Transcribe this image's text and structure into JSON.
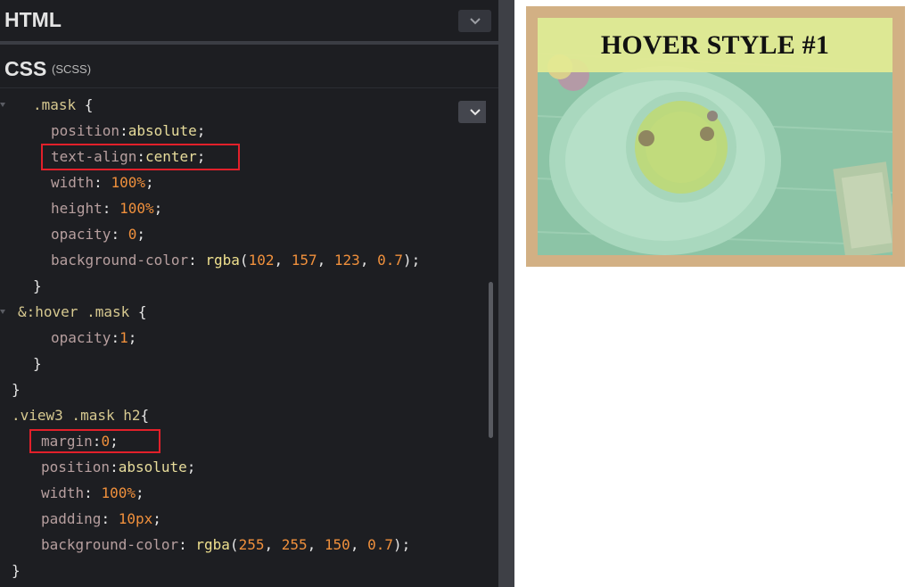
{
  "editor": {
    "html_panel": {
      "title": "HTML"
    },
    "css_panel": {
      "title": "CSS",
      "subtitle": "(SCSS)"
    },
    "code_lines": [
      {
        "tokens": [
          {
            "t": ".mask ",
            "c": "sel"
          },
          {
            "t": "{",
            "c": "pun"
          }
        ]
      },
      {
        "tokens": [
          {
            "t": "position",
            "c": "prop"
          },
          {
            "t": ":",
            "c": "pun"
          },
          {
            "t": "absolute",
            "c": "val"
          },
          {
            "t": ";",
            "c": "pun"
          }
        ]
      },
      {
        "tokens": [
          {
            "t": "text-align",
            "c": "prop"
          },
          {
            "t": ":",
            "c": "pun"
          },
          {
            "t": "center",
            "c": "val"
          },
          {
            "t": ";",
            "c": "pun"
          }
        ]
      },
      {
        "tokens": [
          {
            "t": "width",
            "c": "prop"
          },
          {
            "t": ": ",
            "c": "pun"
          },
          {
            "t": "100%",
            "c": "num"
          },
          {
            "t": ";",
            "c": "pun"
          }
        ]
      },
      {
        "tokens": [
          {
            "t": "height",
            "c": "prop"
          },
          {
            "t": ": ",
            "c": "pun"
          },
          {
            "t": "100%",
            "c": "num"
          },
          {
            "t": ";",
            "c": "pun"
          }
        ]
      },
      {
        "tokens": [
          {
            "t": "opacity",
            "c": "prop"
          },
          {
            "t": ": ",
            "c": "pun"
          },
          {
            "t": "0",
            "c": "num"
          },
          {
            "t": ";",
            "c": "pun"
          }
        ]
      },
      {
        "tokens": [
          {
            "t": "background-color",
            "c": "prop"
          },
          {
            "t": ": ",
            "c": "pun"
          },
          {
            "t": "rgba",
            "c": "fn"
          },
          {
            "t": "(",
            "c": "pun"
          },
          {
            "t": "102",
            "c": "num"
          },
          {
            "t": ", ",
            "c": "pun"
          },
          {
            "t": "157",
            "c": "num"
          },
          {
            "t": ", ",
            "c": "pun"
          },
          {
            "t": "123",
            "c": "num"
          },
          {
            "t": ", ",
            "c": "pun"
          },
          {
            "t": "0.7",
            "c": "num"
          },
          {
            "t": ");",
            "c": "pun"
          }
        ]
      },
      {
        "tokens": [
          {
            "t": "}",
            "c": "pun"
          }
        ]
      },
      {
        "tokens": [
          {
            "t": "&:hover .mask ",
            "c": "sel"
          },
          {
            "t": "{",
            "c": "pun"
          }
        ]
      },
      {
        "tokens": [
          {
            "t": "opacity",
            "c": "prop"
          },
          {
            "t": ":",
            "c": "pun"
          },
          {
            "t": "1",
            "c": "num"
          },
          {
            "t": ";",
            "c": "pun"
          }
        ]
      },
      {
        "tokens": [
          {
            "t": "}",
            "c": "pun"
          }
        ]
      },
      {
        "tokens": [
          {
            "t": "}",
            "c": "pun"
          }
        ]
      },
      {
        "tokens": [
          {
            "t": ".view3 .mask h2",
            "c": "sel"
          },
          {
            "t": "{",
            "c": "pun"
          }
        ]
      },
      {
        "tokens": [
          {
            "t": "margin",
            "c": "prop"
          },
          {
            "t": ":",
            "c": "pun"
          },
          {
            "t": "0",
            "c": "num"
          },
          {
            "t": ";",
            "c": "pun"
          }
        ]
      },
      {
        "tokens": [
          {
            "t": "position",
            "c": "prop"
          },
          {
            "t": ":",
            "c": "pun"
          },
          {
            "t": "absolute",
            "c": "val"
          },
          {
            "t": ";",
            "c": "pun"
          }
        ]
      },
      {
        "tokens": [
          {
            "t": "width",
            "c": "prop"
          },
          {
            "t": ": ",
            "c": "pun"
          },
          {
            "t": "100%",
            "c": "num"
          },
          {
            "t": ";",
            "c": "pun"
          }
        ]
      },
      {
        "tokens": [
          {
            "t": "padding",
            "c": "prop"
          },
          {
            "t": ": ",
            "c": "pun"
          },
          {
            "t": "10px",
            "c": "num"
          },
          {
            "t": ";",
            "c": "pun"
          }
        ]
      },
      {
        "tokens": [
          {
            "t": "background-color",
            "c": "prop"
          },
          {
            "t": ": ",
            "c": "pun"
          },
          {
            "t": "rgba",
            "c": "fn"
          },
          {
            "t": "(",
            "c": "pun"
          },
          {
            "t": "255",
            "c": "num"
          },
          {
            "t": ", ",
            "c": "pun"
          },
          {
            "t": "255",
            "c": "num"
          },
          {
            "t": ", ",
            "c": "pun"
          },
          {
            "t": "150",
            "c": "num"
          },
          {
            "t": ", ",
            "c": "pun"
          },
          {
            "t": "0.7",
            "c": "num"
          },
          {
            "t": ");",
            "c": "pun"
          }
        ]
      },
      {
        "tokens": [
          {
            "t": "}",
            "c": "pun"
          }
        ]
      }
    ]
  },
  "preview": {
    "card_title": "HOVER STYLE #1",
    "image_icon": "teacup-photo"
  },
  "colors": {
    "highlight_box": "#e2202a",
    "card_frame": "#d2b084",
    "caption_bg": "#e4ea92",
    "mask_tint": "#669d7b"
  }
}
